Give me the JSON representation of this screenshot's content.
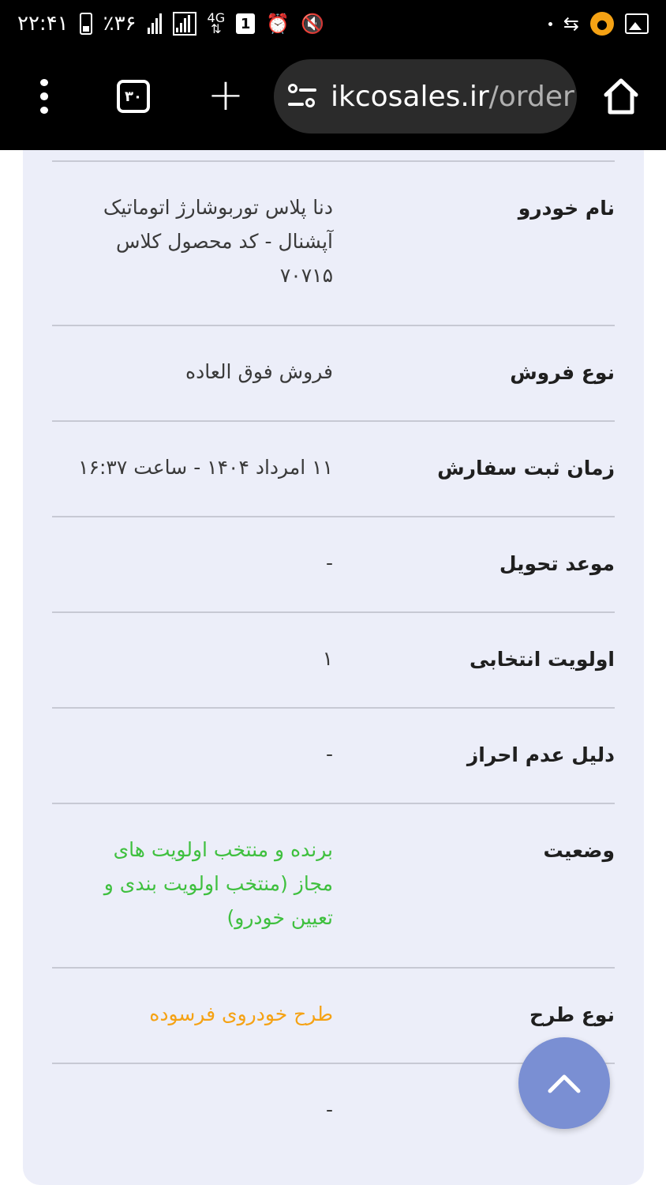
{
  "status_bar": {
    "time": "۲۲:۴۱",
    "battery_percent": "٪۳۶",
    "network_type": "4G",
    "sim_slot": "1"
  },
  "browser": {
    "tab_count": "۳۰",
    "url_domain": "ikcosales.ir",
    "url_path": "/order"
  },
  "details": {
    "rows": [
      {
        "label": "نام خودرو",
        "value_lines": [
          "دنا پلاس توربوشارژ اتوماتیک",
          "آپشنال - کد محصول کلاس",
          "۷۰۷۱۵"
        ]
      },
      {
        "label": "نوع فروش",
        "value": "فروش فوق العاده"
      },
      {
        "label": "زمان ثبت سفارش",
        "value": "۱۱ امرداد ۱۴۰۴ - ساعت ۱۶:۳۷"
      },
      {
        "label": "موعد تحویل",
        "value": "-"
      },
      {
        "label": "اولویت انتخابی",
        "value": "۱"
      },
      {
        "label": "دلیل عدم احراز",
        "value": "-"
      },
      {
        "label": "وضعیت",
        "value_lines": [
          "برنده و منتخب اولویت های",
          "مجاز (منتخب اولویت بندی و",
          "تعیین خودرو)"
        ]
      },
      {
        "label": "نوع طرح",
        "value": "طرح خودروی فرسوده"
      },
      {
        "label": "",
        "value": "-"
      }
    ]
  },
  "colors": {
    "status_ok": "#3fc03f",
    "plan_highlight": "#f5a214",
    "card_bg": "#eceef9",
    "fab_bg": "#7a8fd3"
  },
  "icons": {
    "menu": "more-vert-icon",
    "tabs": "tab-switcher-icon",
    "new_tab": "plus-icon",
    "site_settings": "tune-icon",
    "home": "home-icon",
    "scroll_top": "chevron-up-icon"
  }
}
